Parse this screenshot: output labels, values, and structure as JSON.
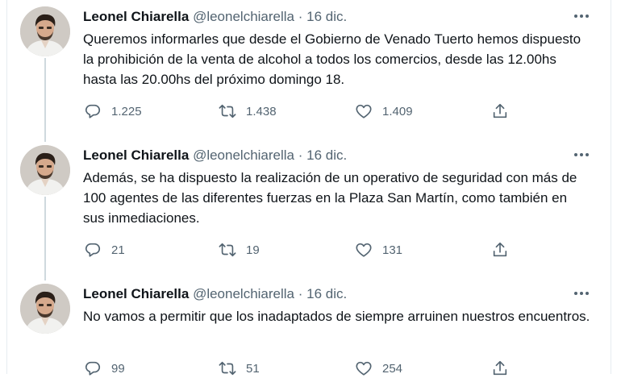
{
  "tweets": [
    {
      "author_name": "Leonel Chiarella",
      "handle": "@leonelchiarella",
      "separator": "·",
      "date": "16 dic.",
      "text": "Queremos informarles que desde el Gobierno de Venado Tuerto hemos dispuesto la prohibición de la venta de alcohol a todos los comercios, desde las 12.00hs hasta las 20.00hs del próximo domingo 18.",
      "replies": "1.225",
      "retweets": "1.438",
      "likes": "1.409"
    },
    {
      "author_name": "Leonel Chiarella",
      "handle": "@leonelchiarella",
      "separator": "·",
      "date": "16 dic.",
      "text": "Además, se ha dispuesto la realización de un operativo de seguridad con más de 100 agentes de las diferentes fuerzas en la Plaza San Martín, como también en sus inmediaciones.",
      "replies": "21",
      "retweets": "19",
      "likes": "131"
    },
    {
      "author_name": "Leonel Chiarella",
      "handle": "@leonelchiarella",
      "separator": "·",
      "date": "16 dic.",
      "text": "No vamos a permitir que los inadaptados de siempre arruinen nuestros encuentros.",
      "replies": "99",
      "retweets": "51",
      "likes": "254"
    }
  ],
  "icons": {
    "reply": "reply-icon",
    "retweet": "retweet-icon",
    "like": "heart-icon",
    "share": "share-icon",
    "more": "more-options-icon"
  },
  "colors": {
    "text": "#0f1419",
    "secondary": "#536471",
    "thread_line": "#cfd9de"
  }
}
